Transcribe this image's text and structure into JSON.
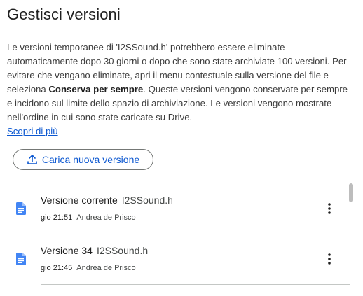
{
  "dialog": {
    "title": "Gestisci versioni",
    "description_part1": "Le versioni temporanee di 'I2SSound.h' potrebbero essere eliminate automaticamente dopo 30 giorni o dopo che sono state archiviate 100 versioni. Per evitare che vengano eliminate, apri il menu contestuale sulla versione del file e seleziona ",
    "description_bold": "Conserva per sempre",
    "description_part2": ". Queste versioni vengono conservate per sempre e incidono sul limite dello spazio di archiviazione. Le versioni vengono mostrate nell'ordine in cui sono state caricate su Drive.",
    "learn_more": "Scopri di più",
    "upload_button": "Carica nuova versione"
  },
  "versions": [
    {
      "label": "Versione corrente",
      "file_name": "I2SSound.h",
      "time": "gio 21:51",
      "author": "Andrea de Prisco"
    },
    {
      "label": "Versione 34",
      "file_name": "I2SSound.h",
      "time": "gio 21:45",
      "author": "Andrea de Prisco"
    }
  ],
  "colors": {
    "accent": "#0b57d0",
    "doc_icon": "#4285f4",
    "divider": "#c4c7c5",
    "text": "#1f1f1f"
  },
  "icons": {
    "upload": "upload-icon",
    "document": "document-icon",
    "more": "more-vert-icon"
  }
}
